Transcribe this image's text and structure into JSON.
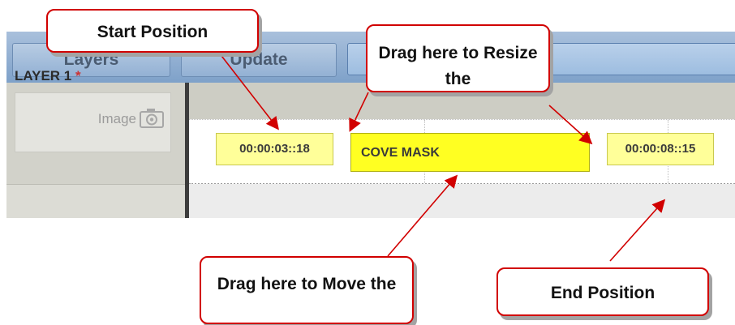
{
  "toolbar": {
    "layers_label": "Layers",
    "update_label": "Update"
  },
  "layer": {
    "title": "LAYER 1",
    "modified_marker": "*",
    "item_label": "Image"
  },
  "timeline": {
    "start_time": "00:00:03::18",
    "clip_name": "COVE MASK",
    "end_time": "00:00:08::15"
  },
  "callouts": {
    "start": "Start Position",
    "resize": "Drag here to Resize the",
    "move": "Drag here to Move the",
    "end": "End Position"
  },
  "colors": {
    "annotation": "#d10000",
    "clip": "#ffff22",
    "time_chip": "#ffff99",
    "toolbar": "#9ab6d8"
  }
}
